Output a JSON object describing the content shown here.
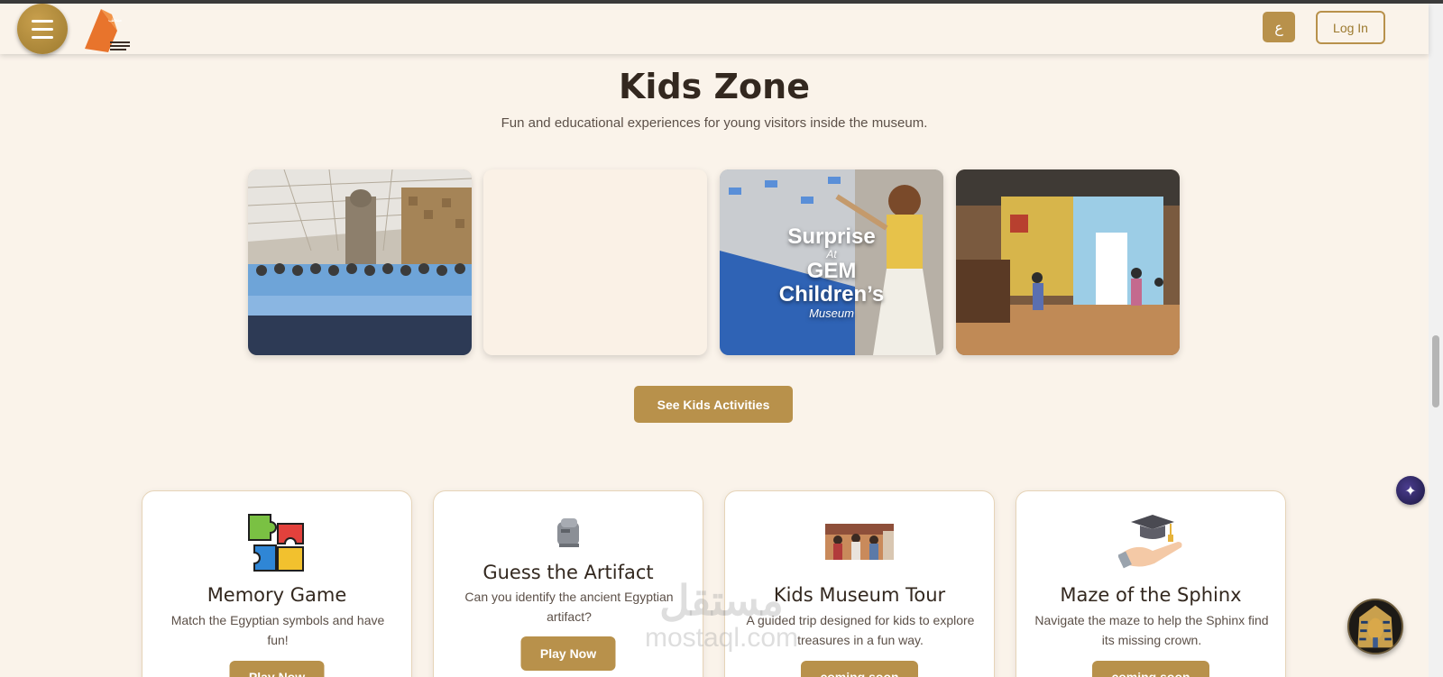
{
  "header": {
    "menu_icon": "hamburger-icon",
    "logo_name": "grand-egyptian-museum-logo",
    "language_label": "ع",
    "login_label": "Log In"
  },
  "hero": {
    "title": "Kids Zone",
    "subtitle": "Fun and educational experiences for young visitors inside the museum."
  },
  "gallery": {
    "overlay_line1": "Surprise",
    "overlay_line2": "At",
    "overlay_line3": "GEM",
    "overlay_line4": "Children’s",
    "overlay_line5": "Museum"
  },
  "kids_button": "See Kids Activities",
  "games": [
    {
      "title": "Memory Game",
      "description": "Match the Egyptian symbols and have fun!",
      "button": "Play Now",
      "icon": "puzzle-icon"
    },
    {
      "title": "Guess the Artifact",
      "description": "Can you identify the ancient Egyptian artifact?",
      "button": "Play Now",
      "icon": "statue-icon"
    },
    {
      "title": "Kids Museum Tour",
      "description": "A guided trip designed for kids to explore treasures in a fun way.",
      "button": "coming soon",
      "icon": "tour-photo-icon"
    },
    {
      "title": "Maze of the Sphinx",
      "description": "Navigate the maze to help the Sphinx find its missing crown.",
      "button": "coming soon",
      "icon": "graduation-cap-icon"
    }
  ],
  "watermark": {
    "arabic": "مستقل",
    "latin": "mostaql.com"
  },
  "colors": {
    "background": "#faf3ea",
    "accent": "#b8914b",
    "text": "#33281f"
  }
}
